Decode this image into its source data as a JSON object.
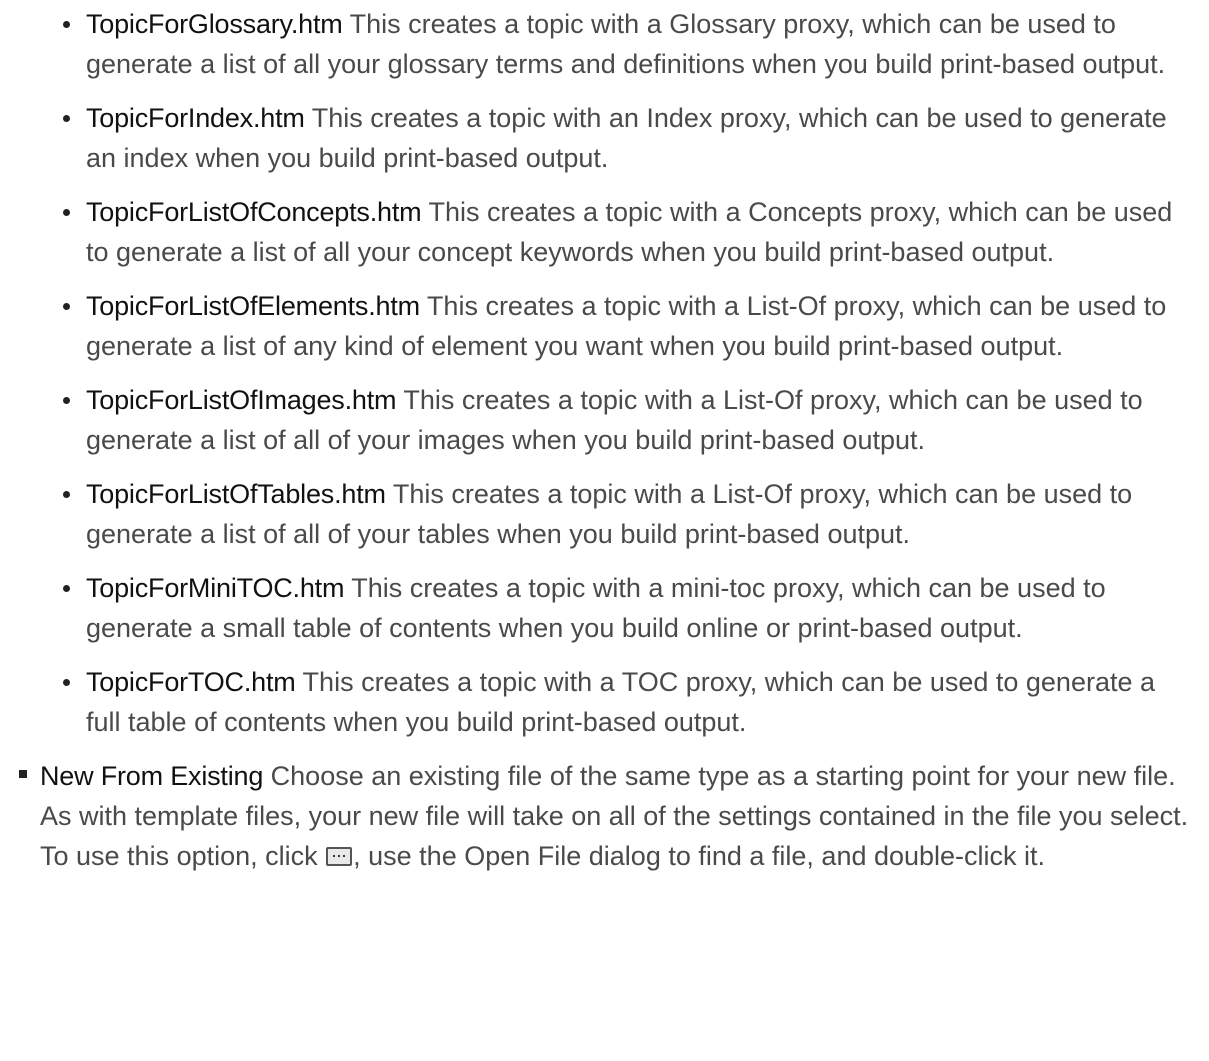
{
  "templates": [
    {
      "name": "TopicForGlossary.htm",
      "desc": " This creates a topic with a Glossary proxy, which can be used to generate a list of all your glossary terms and definitions when you build print-based output."
    },
    {
      "name": "TopicForIndex.htm",
      "desc": " This creates a topic with an Index proxy, which can be used to generate an index when you build print-based output."
    },
    {
      "name": "TopicForListOfConcepts.htm",
      "desc": " This creates a topic with a Concepts proxy, which can be used to generate a list of all your concept keywords when you build print-based output."
    },
    {
      "name": "TopicForListOfElements.htm",
      "desc": " This creates a topic with a List-Of proxy, which can be used to generate a list of any kind of element you want when you build print-based output."
    },
    {
      "name": "TopicForListOfImages.htm",
      "desc": " This creates a topic with a List-Of proxy, which can be used to generate a list of all of your images when you build print-based output."
    },
    {
      "name": "TopicForListOfTables.htm",
      "desc": " This creates a topic with a List-Of proxy, which can be used to generate a list of all of your tables when you build print-based output."
    },
    {
      "name": "TopicForMiniTOC.htm",
      "desc": " This creates a topic with a mini-toc proxy, which can be used to generate a small table of contents when you build online or print-based output."
    },
    {
      "name": "TopicForTOC.htm",
      "desc": " This creates a topic with a TOC proxy, which can be used to generate a full table of contents when you build print-based output."
    }
  ],
  "new_from_existing": {
    "term": "New From Existing",
    "text_before_icon": " Choose an existing file of the same type as a starting point for your new file. As with template files, your new file will take on all of the settings contained in the file you select. To use this option, click ",
    "icon": "browse-ellipsis-icon",
    "text_after_icon": ", use the Open File dialog to find a file, and double-click it."
  }
}
